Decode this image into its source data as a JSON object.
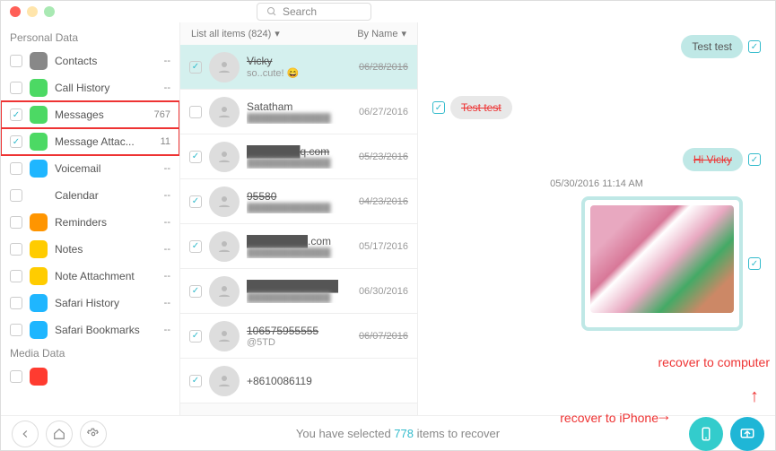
{
  "search": {
    "placeholder": "Search"
  },
  "sidebar": {
    "header1": "Personal Data",
    "header2": "Media Data",
    "items": [
      {
        "label": "Contacts",
        "badge": "--",
        "checked": false,
        "color": "#888"
      },
      {
        "label": "Call History",
        "badge": "--",
        "checked": false,
        "color": "#4cd964"
      },
      {
        "label": "Messages",
        "badge": "767",
        "checked": true,
        "color": "#4cd964"
      },
      {
        "label": "Message Attac...",
        "badge": "11",
        "checked": true,
        "color": "#4cd964"
      },
      {
        "label": "Voicemail",
        "badge": "--",
        "checked": false,
        "color": "#1fb6ff"
      },
      {
        "label": "Calendar",
        "badge": "--",
        "checked": false,
        "color": "#fff"
      },
      {
        "label": "Reminders",
        "badge": "--",
        "checked": false,
        "color": "#ff9500"
      },
      {
        "label": "Notes",
        "badge": "--",
        "checked": false,
        "color": "#ffcc00"
      },
      {
        "label": "Note Attachment",
        "badge": "--",
        "checked": false,
        "color": "#ffcc00"
      },
      {
        "label": "Safari History",
        "badge": "--",
        "checked": false,
        "color": "#1fb6ff"
      },
      {
        "label": "Safari Bookmarks",
        "badge": "--",
        "checked": false,
        "color": "#1fb6ff"
      }
    ]
  },
  "list": {
    "filter": "List all items (824)",
    "sort": "By Name",
    "rows": [
      {
        "name": "Vicky",
        "sub": "so..cute! 😄",
        "date": "06/28/2016",
        "checked": true,
        "strike": true,
        "sel": true
      },
      {
        "name": "Satatham",
        "sub": "████████████",
        "date": "06/27/2016",
        "checked": false,
        "strike": false
      },
      {
        "name": "███████q.com",
        "sub": "████████████",
        "date": "05/23/2016",
        "checked": true,
        "strike": true
      },
      {
        "name": "95580",
        "sub": "████████████",
        "date": "04/23/2016",
        "checked": true,
        "strike": true
      },
      {
        "name": "████████.com",
        "sub": "████████████",
        "date": "05/17/2016",
        "checked": true,
        "strike": false
      },
      {
        "name": "████████████",
        "sub": "████████████",
        "date": "06/30/2016",
        "checked": true,
        "strike": false
      },
      {
        "name": "106575955555",
        "sub": "@5TD",
        "date": "06/07/2016",
        "checked": true,
        "strike": true
      },
      {
        "name": "+8610086119",
        "sub": "",
        "date": "",
        "checked": true,
        "strike": false
      }
    ]
  },
  "conv": {
    "m1": "Test test",
    "m2": "Test test",
    "m3": "Hi Vicky",
    "ts": "05/30/2016 11:14 AM"
  },
  "footer": {
    "prefix": "You have selected ",
    "count": "778",
    "suffix": " items to recover"
  },
  "annotations": {
    "phone": "recover to iPhone",
    "computer": "recover to computer"
  }
}
